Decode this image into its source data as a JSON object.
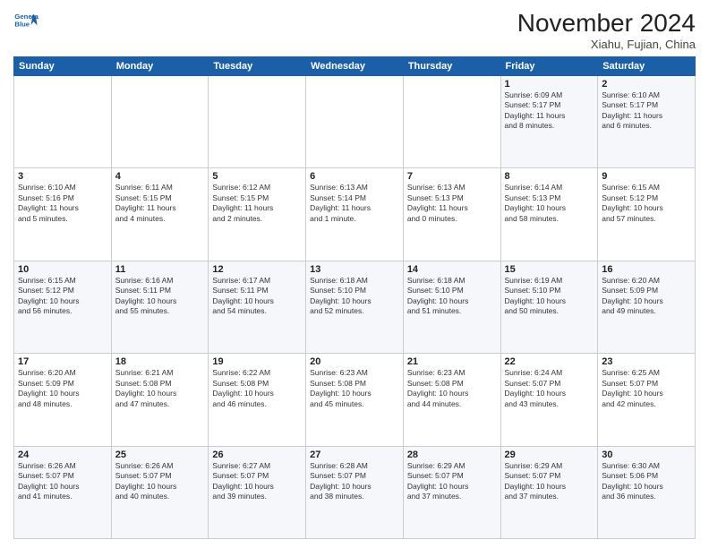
{
  "header": {
    "logo_line1": "General",
    "logo_line2": "Blue",
    "month": "November 2024",
    "location": "Xiahu, Fujian, China"
  },
  "weekdays": [
    "Sunday",
    "Monday",
    "Tuesday",
    "Wednesday",
    "Thursday",
    "Friday",
    "Saturday"
  ],
  "weeks": [
    [
      {
        "day": "",
        "info": ""
      },
      {
        "day": "",
        "info": ""
      },
      {
        "day": "",
        "info": ""
      },
      {
        "day": "",
        "info": ""
      },
      {
        "day": "",
        "info": ""
      },
      {
        "day": "1",
        "info": "Sunrise: 6:09 AM\nSunset: 5:17 PM\nDaylight: 11 hours\nand 8 minutes."
      },
      {
        "day": "2",
        "info": "Sunrise: 6:10 AM\nSunset: 5:17 PM\nDaylight: 11 hours\nand 6 minutes."
      }
    ],
    [
      {
        "day": "3",
        "info": "Sunrise: 6:10 AM\nSunset: 5:16 PM\nDaylight: 11 hours\nand 5 minutes."
      },
      {
        "day": "4",
        "info": "Sunrise: 6:11 AM\nSunset: 5:15 PM\nDaylight: 11 hours\nand 4 minutes."
      },
      {
        "day": "5",
        "info": "Sunrise: 6:12 AM\nSunset: 5:15 PM\nDaylight: 11 hours\nand 2 minutes."
      },
      {
        "day": "6",
        "info": "Sunrise: 6:13 AM\nSunset: 5:14 PM\nDaylight: 11 hours\nand 1 minute."
      },
      {
        "day": "7",
        "info": "Sunrise: 6:13 AM\nSunset: 5:13 PM\nDaylight: 11 hours\nand 0 minutes."
      },
      {
        "day": "8",
        "info": "Sunrise: 6:14 AM\nSunset: 5:13 PM\nDaylight: 10 hours\nand 58 minutes."
      },
      {
        "day": "9",
        "info": "Sunrise: 6:15 AM\nSunset: 5:12 PM\nDaylight: 10 hours\nand 57 minutes."
      }
    ],
    [
      {
        "day": "10",
        "info": "Sunrise: 6:15 AM\nSunset: 5:12 PM\nDaylight: 10 hours\nand 56 minutes."
      },
      {
        "day": "11",
        "info": "Sunrise: 6:16 AM\nSunset: 5:11 PM\nDaylight: 10 hours\nand 55 minutes."
      },
      {
        "day": "12",
        "info": "Sunrise: 6:17 AM\nSunset: 5:11 PM\nDaylight: 10 hours\nand 54 minutes."
      },
      {
        "day": "13",
        "info": "Sunrise: 6:18 AM\nSunset: 5:10 PM\nDaylight: 10 hours\nand 52 minutes."
      },
      {
        "day": "14",
        "info": "Sunrise: 6:18 AM\nSunset: 5:10 PM\nDaylight: 10 hours\nand 51 minutes."
      },
      {
        "day": "15",
        "info": "Sunrise: 6:19 AM\nSunset: 5:10 PM\nDaylight: 10 hours\nand 50 minutes."
      },
      {
        "day": "16",
        "info": "Sunrise: 6:20 AM\nSunset: 5:09 PM\nDaylight: 10 hours\nand 49 minutes."
      }
    ],
    [
      {
        "day": "17",
        "info": "Sunrise: 6:20 AM\nSunset: 5:09 PM\nDaylight: 10 hours\nand 48 minutes."
      },
      {
        "day": "18",
        "info": "Sunrise: 6:21 AM\nSunset: 5:08 PM\nDaylight: 10 hours\nand 47 minutes."
      },
      {
        "day": "19",
        "info": "Sunrise: 6:22 AM\nSunset: 5:08 PM\nDaylight: 10 hours\nand 46 minutes."
      },
      {
        "day": "20",
        "info": "Sunrise: 6:23 AM\nSunset: 5:08 PM\nDaylight: 10 hours\nand 45 minutes."
      },
      {
        "day": "21",
        "info": "Sunrise: 6:23 AM\nSunset: 5:08 PM\nDaylight: 10 hours\nand 44 minutes."
      },
      {
        "day": "22",
        "info": "Sunrise: 6:24 AM\nSunset: 5:07 PM\nDaylight: 10 hours\nand 43 minutes."
      },
      {
        "day": "23",
        "info": "Sunrise: 6:25 AM\nSunset: 5:07 PM\nDaylight: 10 hours\nand 42 minutes."
      }
    ],
    [
      {
        "day": "24",
        "info": "Sunrise: 6:26 AM\nSunset: 5:07 PM\nDaylight: 10 hours\nand 41 minutes."
      },
      {
        "day": "25",
        "info": "Sunrise: 6:26 AM\nSunset: 5:07 PM\nDaylight: 10 hours\nand 40 minutes."
      },
      {
        "day": "26",
        "info": "Sunrise: 6:27 AM\nSunset: 5:07 PM\nDaylight: 10 hours\nand 39 minutes."
      },
      {
        "day": "27",
        "info": "Sunrise: 6:28 AM\nSunset: 5:07 PM\nDaylight: 10 hours\nand 38 minutes."
      },
      {
        "day": "28",
        "info": "Sunrise: 6:29 AM\nSunset: 5:07 PM\nDaylight: 10 hours\nand 37 minutes."
      },
      {
        "day": "29",
        "info": "Sunrise: 6:29 AM\nSunset: 5:07 PM\nDaylight: 10 hours\nand 37 minutes."
      },
      {
        "day": "30",
        "info": "Sunrise: 6:30 AM\nSunset: 5:06 PM\nDaylight: 10 hours\nand 36 minutes."
      }
    ]
  ]
}
